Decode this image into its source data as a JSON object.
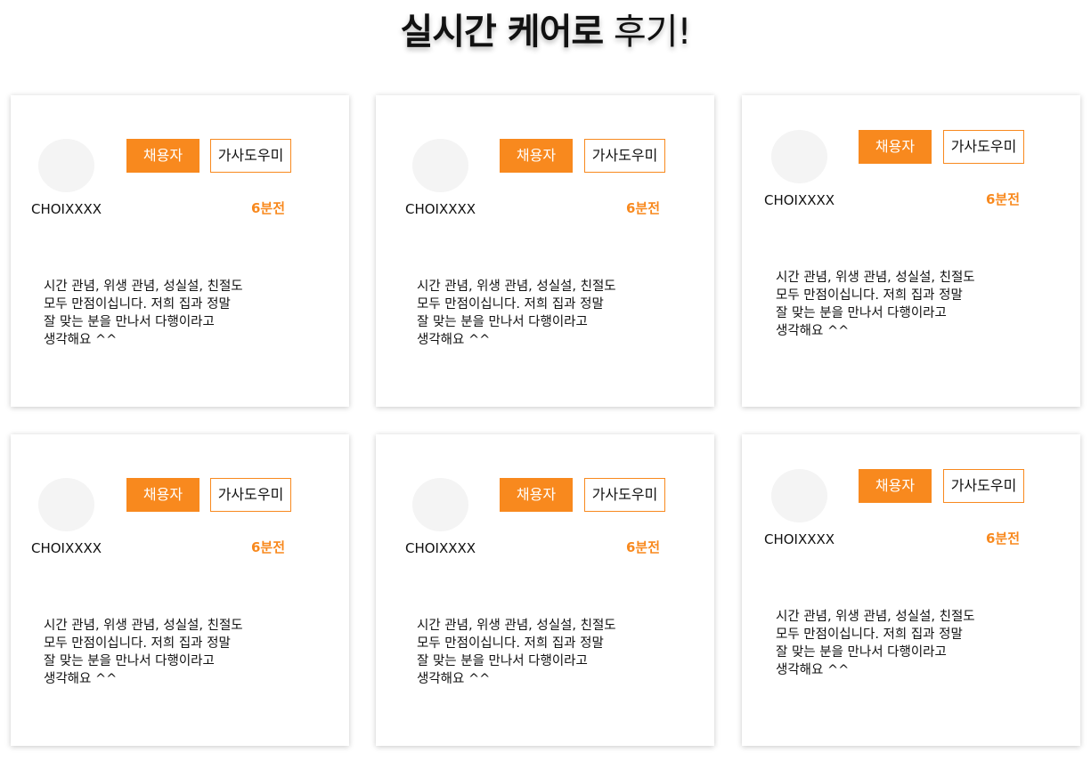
{
  "title": {
    "bold_part": "실시간 케어로",
    "light_part": " 후기!"
  },
  "colors": {
    "accent": "#f8891e",
    "avatar_placeholder": "#f4f4f4"
  },
  "reviews": [
    {
      "role": "채용자",
      "service": "가사도우미",
      "user": "CHOIXXXX",
      "time": "6분전",
      "text": "시간 관념, 위생 관념, 성실설, 친절도\n모두 만점이십니다. 저희 집과 정말\n잘 맞는 분을 만나서 다행이라고\n생각해요 ^^"
    },
    {
      "role": "채용자",
      "service": "가사도우미",
      "user": "CHOIXXXX",
      "time": "6분전",
      "text": "시간 관념, 위생 관념, 성실설, 친절도\n모두 만점이십니다. 저희 집과 정말\n잘 맞는 분을 만나서 다행이라고\n생각해요 ^^"
    },
    {
      "role": "채용자",
      "service": "가사도우미",
      "user": "CHOIXXXX",
      "time": "6분전",
      "text": "시간 관념, 위생 관념, 성실설, 친절도\n모두 만점이십니다. 저희 집과 정말\n잘 맞는 분을 만나서 다행이라고\n생각해요 ^^"
    },
    {
      "role": "채용자",
      "service": "가사도우미",
      "user": "CHOIXXXX",
      "time": "6분전",
      "text": "시간 관념, 위생 관념, 성실설, 친절도\n모두 만점이십니다. 저희 집과 정말\n잘 맞는 분을 만나서 다행이라고\n생각해요 ^^"
    },
    {
      "role": "채용자",
      "service": "가사도우미",
      "user": "CHOIXXXX",
      "time": "6분전",
      "text": "시간 관념, 위생 관념, 성실설, 친절도\n모두 만점이십니다. 저희 집과 정말\n잘 맞는 분을 만나서 다행이라고\n생각해요 ^^"
    },
    {
      "role": "채용자",
      "service": "가사도우미",
      "user": "CHOIXXXX",
      "time": "6분전",
      "text": "시간 관념, 위생 관념, 성실설, 친절도\n모두 만점이십니다. 저희 집과 정말\n잘 맞는 분을 만나서 다행이라고\n생각해요 ^^"
    }
  ]
}
